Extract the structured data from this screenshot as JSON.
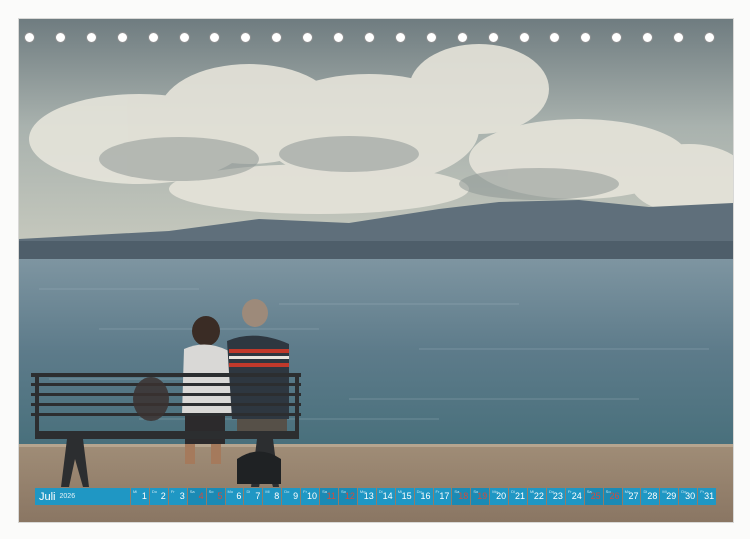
{
  "calendar": {
    "month": "Juli",
    "year": "2026",
    "days": [
      {
        "num": "1",
        "weekday": "Mi",
        "holiday": false,
        "weekend": false
      },
      {
        "num": "2",
        "weekday": "Do",
        "holiday": false,
        "weekend": false
      },
      {
        "num": "3",
        "weekday": "Fr",
        "holiday": false,
        "weekend": false
      },
      {
        "num": "4",
        "weekday": "Sa",
        "holiday": true,
        "weekend": true
      },
      {
        "num": "5",
        "weekday": "So",
        "holiday": true,
        "weekend": true
      },
      {
        "num": "6",
        "weekday": "Mo",
        "holiday": false,
        "weekend": false
      },
      {
        "num": "7",
        "weekday": "Di",
        "holiday": false,
        "weekend": false
      },
      {
        "num": "8",
        "weekday": "Mi",
        "holiday": false,
        "weekend": false
      },
      {
        "num": "9",
        "weekday": "Do",
        "holiday": false,
        "weekend": false
      },
      {
        "num": "10",
        "weekday": "Fr",
        "holiday": false,
        "weekend": false
      },
      {
        "num": "11",
        "weekday": "Sa",
        "holiday": true,
        "weekend": true
      },
      {
        "num": "12",
        "weekday": "So",
        "holiday": true,
        "weekend": true
      },
      {
        "num": "13",
        "weekday": "Mo",
        "holiday": false,
        "weekend": false
      },
      {
        "num": "14",
        "weekday": "Di",
        "holiday": false,
        "weekend": false
      },
      {
        "num": "15",
        "weekday": "Mi",
        "holiday": false,
        "weekend": false
      },
      {
        "num": "16",
        "weekday": "Do",
        "holiday": false,
        "weekend": false
      },
      {
        "num": "17",
        "weekday": "Fr",
        "holiday": false,
        "weekend": false
      },
      {
        "num": "18",
        "weekday": "Sa",
        "holiday": true,
        "weekend": true
      },
      {
        "num": "19",
        "weekday": "So",
        "holiday": true,
        "weekend": true
      },
      {
        "num": "20",
        "weekday": "Mo",
        "holiday": false,
        "weekend": false
      },
      {
        "num": "21",
        "weekday": "Di",
        "holiday": false,
        "weekend": false
      },
      {
        "num": "22",
        "weekday": "Mi",
        "holiday": false,
        "weekend": false
      },
      {
        "num": "23",
        "weekday": "Do",
        "holiday": false,
        "weekend": false
      },
      {
        "num": "24",
        "weekday": "Fr",
        "holiday": false,
        "weekend": false
      },
      {
        "num": "25",
        "weekday": "Sa",
        "holiday": true,
        "weekend": true
      },
      {
        "num": "26",
        "weekday": "So",
        "holiday": true,
        "weekend": true
      },
      {
        "num": "27",
        "weekday": "Mo",
        "holiday": false,
        "weekend": false
      },
      {
        "num": "28",
        "weekday": "Di",
        "holiday": false,
        "weekend": false
      },
      {
        "num": "29",
        "weekday": "Mi",
        "holiday": false,
        "weekend": false
      },
      {
        "num": "30",
        "weekday": "Do",
        "holiday": false,
        "weekend": false
      },
      {
        "num": "31",
        "weekday": "Fr",
        "holiday": false,
        "weekend": false
      }
    ]
  },
  "colors": {
    "strip_blue": "#1f97c4",
    "holiday_red": "#d64b3b",
    "hole_border": "#8d8f90"
  }
}
